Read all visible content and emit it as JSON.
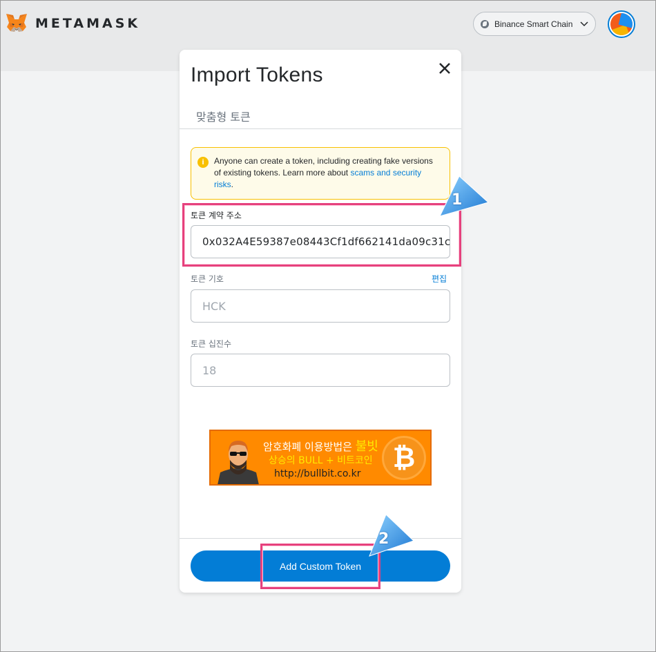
{
  "app": {
    "brand": "METAMASK",
    "network": "Binance Smart Chain"
  },
  "dialog": {
    "title": "Import Tokens",
    "tab_custom": "맞춤형 토큰",
    "warning_text": "Anyone can create a token, including creating fake versions of existing tokens. Learn more about ",
    "warning_link": "scams and security risks",
    "warning_suffix": ".",
    "address_label": "토큰 계약 주소",
    "address_value": "0x032A4E59387e08443Cf1df662141da09c31c",
    "symbol_label": "토큰 기호",
    "symbol_edit": "편집",
    "symbol_value": "HCK",
    "decimals_label": "토큰 십진수",
    "decimals_value": "18",
    "submit_label": "Add Custom Token"
  },
  "banner": {
    "line1_prefix": "암호화폐 이용방법은 ",
    "line1_highlight": "불빗",
    "line2": "상승의 BULL + 비트코인",
    "line3": "http://bullbit.co.kr",
    "coin_symbol": "₿"
  },
  "annotations": {
    "step1": "1",
    "step2": "2"
  },
  "colors": {
    "accent": "#037dd6",
    "warning": "#f8c000",
    "highlight": "#e6417d"
  }
}
